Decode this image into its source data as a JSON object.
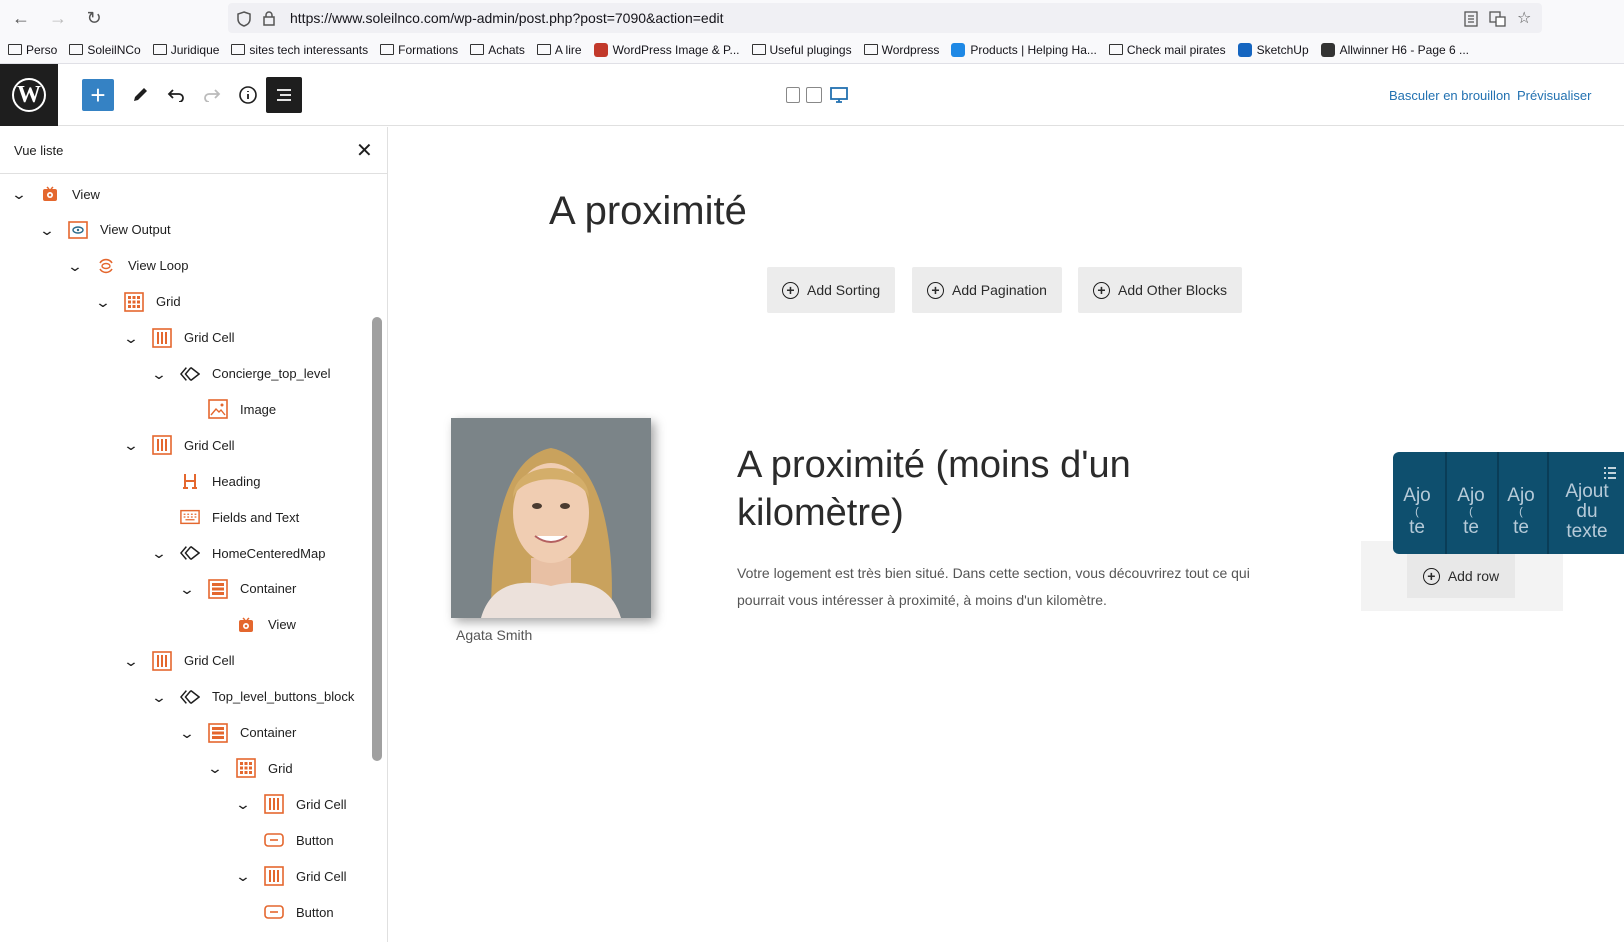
{
  "browser": {
    "url": "https://www.soleilnco.com/wp-admin/post.php?post=7090&action=edit",
    "bookmarks": [
      {
        "label": "Perso",
        "type": "folder"
      },
      {
        "label": "SoleilNCo",
        "type": "folder"
      },
      {
        "label": "Juridique",
        "type": "folder"
      },
      {
        "label": "sites tech interessants",
        "type": "folder"
      },
      {
        "label": "Formations",
        "type": "folder"
      },
      {
        "label": "Achats",
        "type": "folder"
      },
      {
        "label": "A lire",
        "type": "folder"
      },
      {
        "label": "WordPress Image & P...",
        "type": "site",
        "color": "#c2392b"
      },
      {
        "label": "Useful plugings",
        "type": "folder"
      },
      {
        "label": "Wordpress",
        "type": "folder"
      },
      {
        "label": "Products | Helping Ha...",
        "type": "site",
        "color": "#1e88e5"
      },
      {
        "label": "Check mail pirates",
        "type": "folder"
      },
      {
        "label": "SketchUp",
        "type": "site",
        "color": "#1565c0"
      },
      {
        "label": "Allwinner H6 - Page 6 ...",
        "type": "site",
        "color": "#333333"
      }
    ]
  },
  "toolbar": {
    "switch_draft": "Basculer en brouillon",
    "preview": "Prévisualiser",
    "accent": "#3582c4"
  },
  "listview": {
    "title": "Vue liste",
    "items": [
      {
        "label": "View",
        "icon": "view-icon",
        "chevron": true
      },
      {
        "label": "View Output",
        "icon": "view-output-icon",
        "chevron": true
      },
      {
        "label": "View Loop",
        "icon": "view-loop-icon",
        "chevron": true
      },
      {
        "label": "Grid",
        "icon": "grid-icon",
        "chevron": true
      },
      {
        "label": "Grid Cell",
        "icon": "grid-cell-icon",
        "chevron": true
      },
      {
        "label": "Concierge_top_level",
        "icon": "reusable-block-icon",
        "chevron": true
      },
      {
        "label": "Image",
        "icon": "image-icon",
        "chevron": false
      },
      {
        "label": "Grid Cell",
        "icon": "grid-cell-icon",
        "chevron": true
      },
      {
        "label": "Heading",
        "icon": "heading-icon",
        "chevron": false
      },
      {
        "label": "Fields and Text",
        "icon": "fields-text-icon",
        "chevron": false
      },
      {
        "label": "HomeCenteredMap",
        "icon": "reusable-block-icon",
        "chevron": true
      },
      {
        "label": "Container",
        "icon": "container-icon",
        "chevron": true
      },
      {
        "label": "View",
        "icon": "view-icon",
        "chevron": false
      },
      {
        "label": "Grid Cell",
        "icon": "grid-cell-icon",
        "chevron": true
      },
      {
        "label": "Top_level_buttons_block",
        "icon": "reusable-block-icon",
        "chevron": true
      },
      {
        "label": "Container",
        "icon": "container-icon",
        "chevron": true
      },
      {
        "label": "Grid",
        "icon": "grid-icon",
        "chevron": true
      },
      {
        "label": "Grid Cell",
        "icon": "grid-cell-icon",
        "chevron": true
      },
      {
        "label": "Button",
        "icon": "button-icon",
        "chevron": false
      },
      {
        "label": "Grid Cell",
        "icon": "grid-cell-icon",
        "chevron": true
      },
      {
        "label": "Button",
        "icon": "button-icon",
        "chevron": false
      }
    ],
    "icon_color": "#e4672e"
  },
  "canvas": {
    "heading": "A proximité",
    "buttons": [
      "Add Sorting",
      "Add Pagination",
      "Add Other Blocks"
    ],
    "caption": "Agata Smith",
    "section_heading": "A proximité (moins d'un kilomètre)",
    "description": "Votre logement est très bien situé. Dans cette section, vous découvrirez tout ce qui pourrait vous intéresser à proximité, à moins d'un kilomètre.",
    "add_row": "Add row",
    "overlay_columns": [
      {
        "line1": "Ajo",
        "line2": "(",
        "line3": "te"
      },
      {
        "line1": "Ajo",
        "line2": "(",
        "line3": "te"
      },
      {
        "line1": "Ajo",
        "line2": "(",
        "line3": "te"
      },
      {
        "line1": "Ajout",
        "line2": "du",
        "line3": "texte"
      }
    ],
    "overlay_color": "#0e4f6e"
  }
}
